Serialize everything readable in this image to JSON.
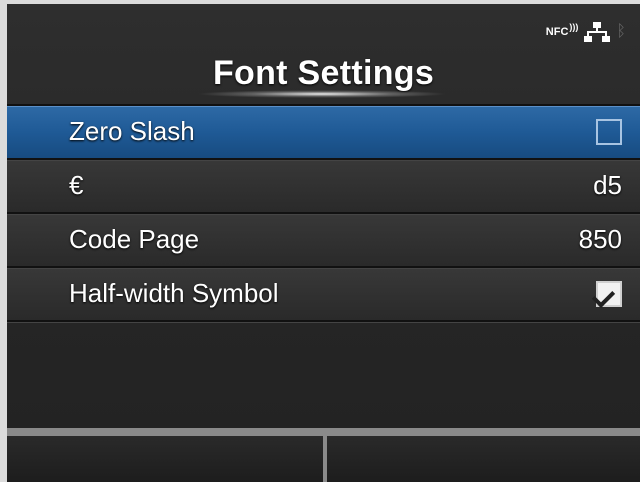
{
  "header": {
    "title": "Font Settings",
    "status_icons": [
      "nfc-icon",
      "network-icon",
      "bluetooth-icon"
    ],
    "nfc_label": "NFC"
  },
  "menu": {
    "items": [
      {
        "label": "Zero Slash",
        "type": "checkbox",
        "checked": false,
        "selected": true
      },
      {
        "label": "€",
        "type": "value",
        "value": "d5"
      },
      {
        "label": "Code Page",
        "type": "value",
        "value": "850"
      },
      {
        "label": "Half-width Symbol",
        "type": "checkbox",
        "checked": true
      }
    ]
  },
  "colors": {
    "selected_row": "#1f5a96",
    "background": "#2a2a2a",
    "text": "#ffffff"
  }
}
